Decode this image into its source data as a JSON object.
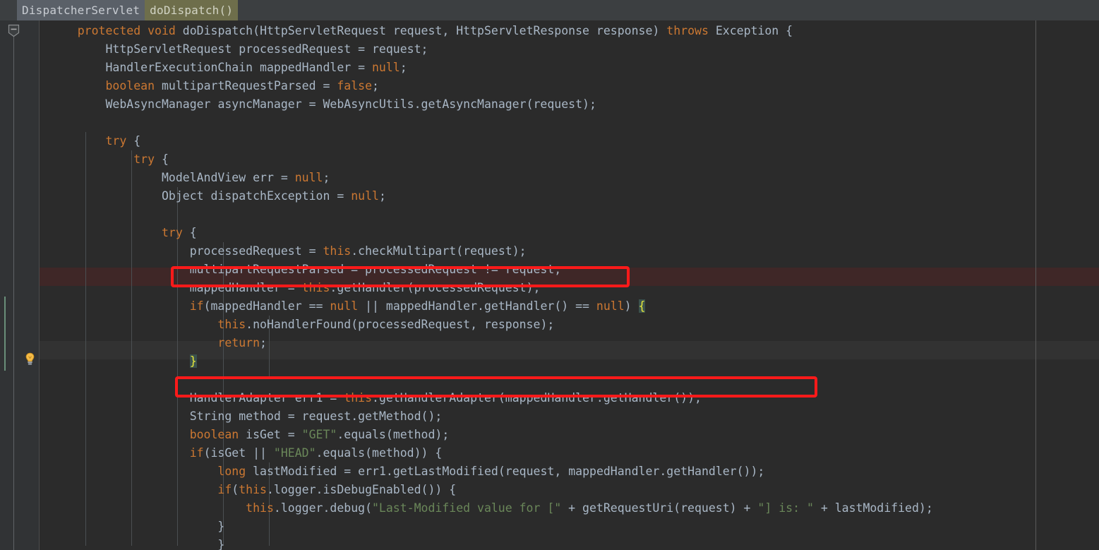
{
  "breadcrumb": {
    "class": "DispatcherServlet",
    "method": "doDispatch()"
  },
  "gutter": {
    "fold_marker": "fold-collapse-icon",
    "lightbulb": "intention-bulb-icon",
    "change_marker": "vcs-modified-line-marker"
  },
  "editor": {
    "language": "java",
    "colors": {
      "background": "#2b2b2b",
      "gutter": "#313335",
      "keyword": "#cc7832",
      "identifier": "#a9b7c6",
      "string": "#6a8759",
      "highlight_line": "#3f2727",
      "brace_match": "#3b514d",
      "annotation_box": "#fe1a1a",
      "change_marker": "#6a8f7a",
      "crumb_class_bg": "#5a6068",
      "crumb_method_bg": "#6e6e4b"
    },
    "lines": [
      "    protected void doDispatch(HttpServletRequest request, HttpServletResponse response) throws Exception {",
      "        HttpServletRequest processedRequest = request;",
      "        HandlerExecutionChain mappedHandler = null;",
      "        boolean multipartRequestParsed = false;",
      "        WebAsyncManager asyncManager = WebAsyncUtils.getAsyncManager(request);",
      "",
      "        try {",
      "            try {",
      "                ModelAndView err = null;",
      "                Object dispatchException = null;",
      "",
      "                try {",
      "                    processedRequest = this.checkMultipart(request);",
      "                    multipartRequestParsed = processedRequest != request;",
      "                    mappedHandler = this.getHandler(processedRequest);",
      "                    if(mappedHandler == null || mappedHandler.getHandler() == null) {",
      "                        this.noHandlerFound(processedRequest, response);",
      "                        return;",
      "                    }",
      "",
      "                    HandlerAdapter err1 = this.getHandlerAdapter(mappedHandler.getHandler());",
      "                    String method = request.getMethod();",
      "                    boolean isGet = \"GET\".equals(method);",
      "                    if(isGet || \"HEAD\".equals(method)) {",
      "                        long lastModified = err1.getLastModified(request, mappedHandler.getHandler());",
      "                        if(this.logger.isDebugEnabled()) {",
      "                            this.logger.debug(\"Last-Modified value for [\" + getRequestUri(request) + \"] is: \" + lastModified);",
      "                        }",
      "                        }"
    ]
  },
  "annotations": [
    {
      "name": "highlight-box-get-handler",
      "target_code": "mappedHandler = this.getHandler(processedRequest);"
    },
    {
      "name": "highlight-box-get-handler-adapter",
      "target_code": "HandlerAdapter err1 = this.getHandlerAdapter(mappedHandler.getHandler());"
    }
  ]
}
